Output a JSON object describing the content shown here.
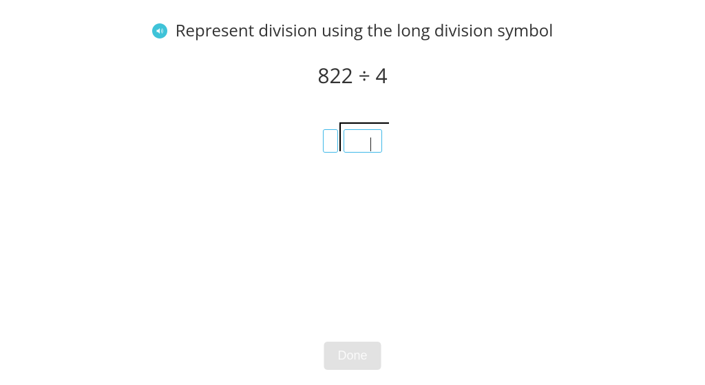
{
  "header": {
    "instruction": "Represent division using the long division symbol",
    "audio_icon": "audio-icon"
  },
  "problem": {
    "expression": "822 ÷ 4",
    "divisor_value": "",
    "dividend_value": ""
  },
  "footer": {
    "done_label": "Done"
  }
}
